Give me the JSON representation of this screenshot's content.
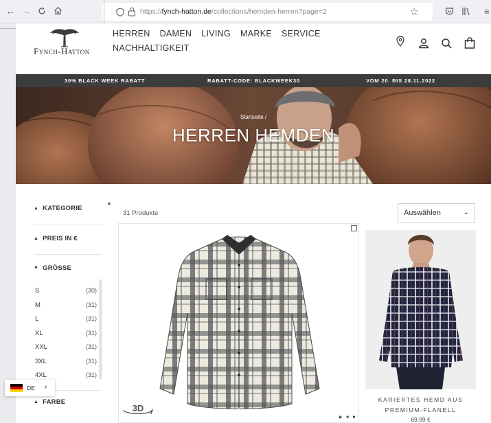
{
  "browser": {
    "url_domain": "fynch-hatton.de",
    "url_prefix": "https://",
    "url_path": "/collections/hemden-herren?page=2"
  },
  "header": {
    "logo_text": "Fynch-Hatton",
    "nav": [
      "HERREN",
      "DAMEN",
      "LIVING",
      "MARKE",
      "SERVICE",
      "NACHHALTIGKEIT"
    ]
  },
  "promo": {
    "left": "30% BLACK WEEK RABATT",
    "middle": "RABATT-CODE: BLACKWEEK30",
    "right": "VOM 20. BIS 28.11.2022"
  },
  "hero": {
    "breadcrumb": "Startseite /",
    "title": "HERREN HEMDEN"
  },
  "filters": {
    "kategorie": "KATEGORIE",
    "preis": "PREIS IN €",
    "groesse": "GRÖSSE",
    "sizes": [
      {
        "label": "S",
        "count": "(30)"
      },
      {
        "label": "M",
        "count": "(31)"
      },
      {
        "label": "L",
        "count": "(31)"
      },
      {
        "label": "XL",
        "count": "(31)"
      },
      {
        "label": "XXL",
        "count": "(31)"
      },
      {
        "label": "3XL",
        "count": "(31)"
      },
      {
        "label": "4XL",
        "count": "(31)"
      }
    ],
    "farbe": "FARBE"
  },
  "language": {
    "code": "DE",
    "arrow": "›"
  },
  "products": {
    "count_label": "31 Produkte",
    "sort_label": "Auswählen",
    "badge_3d": "3D",
    "item2_name": "KARIERTES HEMD AUS PREMIUM-FLANELL",
    "item2_price": "69,99 €"
  },
  "colors": {
    "promo_bg": "#3c3c3c",
    "page_bg": "#ffffff",
    "chrome_bg": "#f0f0f4"
  }
}
